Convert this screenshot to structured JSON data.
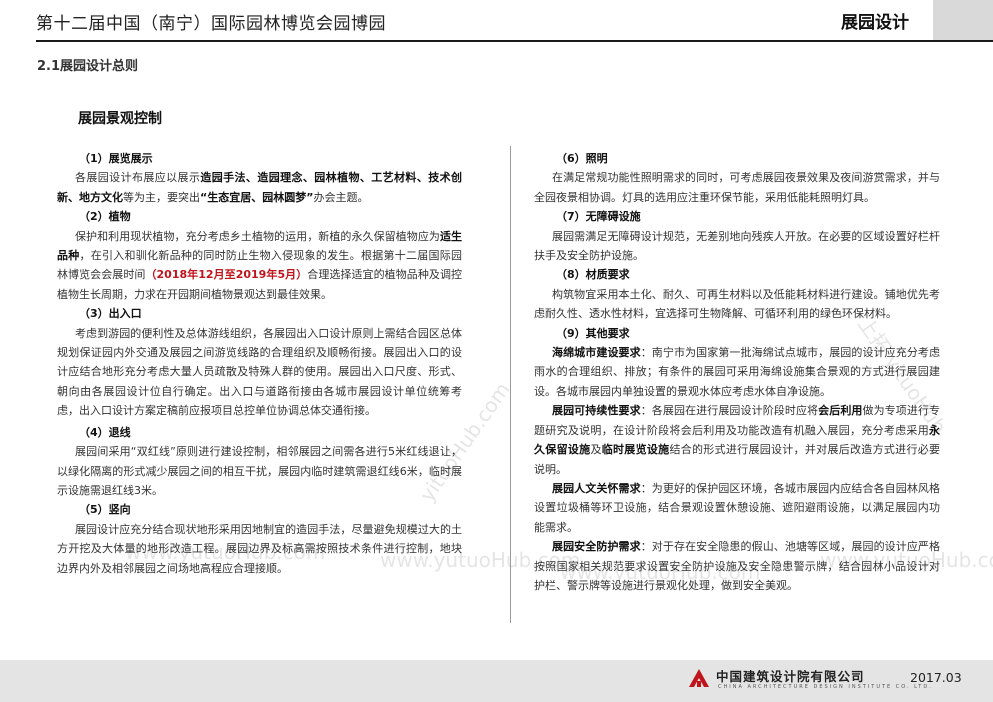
{
  "header": {
    "title": "第十二届中国（南宁）国际园林博览会园博园",
    "section": "展园设计"
  },
  "section_heading": "2.1展园设计总则",
  "sub_heading": "展园景观控制",
  "left": {
    "s1_title": "（1）展览展示",
    "s1_a": "各展园设计布展应以展示",
    "s1_b": "造园手法、造园理念、园林植物、工艺材料、技术创新、地方文化",
    "s1_c": "等为主，要突出",
    "s1_d": "“生态宜居、园林圆梦”",
    "s1_e": "办会主题。",
    "s2_title": "（2）植物",
    "s2_a": "保护和利用现状植物，充分考虑乡土植物的运用，新植的永久保留植物应为",
    "s2_b": "适生品种",
    "s2_c": "，在引入和驯化新品种的同时防止生物入侵现象的发生。根据第十二届国际园林博览会会展时间",
    "s2_d": "（2018年12月至2019年5月）",
    "s2_e": "合理选择适宜的植物品种及调控植物生长周期，力求在开园期间植物景观达到最佳效果。",
    "s3_title": "（3）出入口",
    "s3_a": "考虑到游园的便利性及总体游线组织，各展园出入口设计原则上需结合园区总体规划保证园内外交通及展园之间游览线路的合理组织及顺畅衔接。展园出入口的设计应结合地形充分考虑大量人员疏散及特殊人群的使用。展园出入口尺度、形式、朝向由各展园设计位自行确定。出入口与道路衔接由各城市展园设计单位统筹考虑，出入口设计方案定稿前应报项目总控单位协调总体交通衔接。",
    "s4_title": "（4）退线",
    "s4_a": "展园间采用“双红线”原则进行建设控制，相邻展园之间需各进行5米红线退让，以绿化隔离的形式减少展园之间的相互干扰，展园内临时建筑需退红线6米，临时展示设施需退红线3米。",
    "s5_title": "（5）竖向",
    "s5_a": "展园设计应充分结合现状地形采用因地制宜的造园手法，尽量避免规模过大的土方开挖及大体量的地形改造工程。展园边界及标高需按照技术条件进行控制，地块边界内外及相邻展园之间场地高程应合理接顺。"
  },
  "right": {
    "s6_title": "（6）照明",
    "s6_a": "在满足常规功能性照明需求的同时，可考虑展园夜景效果及夜间游赏需求，并与全园夜景相协调。灯具的选用应注重环保节能，采用低能耗照明灯具。",
    "s7_title": "（7）无障碍设施",
    "s7_a": "展园需满足无障碍设计规范，无差别地向残疾人开放。在必要的区域设置好栏杆扶手及安全防护设施。",
    "s8_title": "（8）材质要求",
    "s8_a": "构筑物宜采用本土化、耐久、可再生材料以及低能耗材料进行建设。铺地优先考虑耐久性、透水性材料，宜选择可生物降解、可循环利用的绿色环保材料。",
    "s9_title": "（9）其他要求",
    "r1_label": "海绵城市建设要求",
    "r1_text": "：南宁市为国家第一批海绵试点城市，展园的设计应充分考虑雨水的合理组织、排放；有条件的展园可采用海绵设施集合景观的方式进行展园建设。各城市展园内单独设置的景观水体应考虑水体自净设施。",
    "r2_label": "展园可持续性要求",
    "r2_a": "：各展园在进行展园设计阶段时应将",
    "r2_b": "会后利用",
    "r2_c": "做为专项进行专题研究及说明，在设计阶段将会后利用及功能改造有机融入展园，充分考虑采用",
    "r2_d": "永久保留设施",
    "r2_e": "及",
    "r2_f": "临时展览设施",
    "r2_g": "结合的形式进行展园设计，并对展后改造方式进行必要说明。",
    "r3_label": "展园人文关怀需求",
    "r3_text": "：为更好的保护园区环境，各城市展园内应结合各自园林风格设置垃圾桶等环卫设施，结合景观设置休憩设施、遮阳避雨设施，以满足展园内功能需求。",
    "r4_label": "展园安全防护需求",
    "r4_text": "：对于存在安全隐患的假山、池塘等区域，展园的设计应严格按照国家相关规范要求设置安全防护设施及安全隐患警示牌，结合园林小品设计对护栏、警示牌等设施进行景观化处理，做到安全美观。"
  },
  "watermarks": [
    "www.yutuoHub.com",
    "yituoHub.com",
    "www.yutuoHub.com",
    "www.yutuoHub.com",
    "上拓 yituoHub"
  ],
  "footer": {
    "company": "中国建筑设计院有限公司",
    "company_en": "CHINA ARCHITECTURE DESIGN INSTITUTE CO. LTD.",
    "date": "2017.03"
  },
  "colors": {
    "accent_red": "#c0141c",
    "footer_bg": "#e4e4e4",
    "header_block": "#d9d9d9"
  }
}
